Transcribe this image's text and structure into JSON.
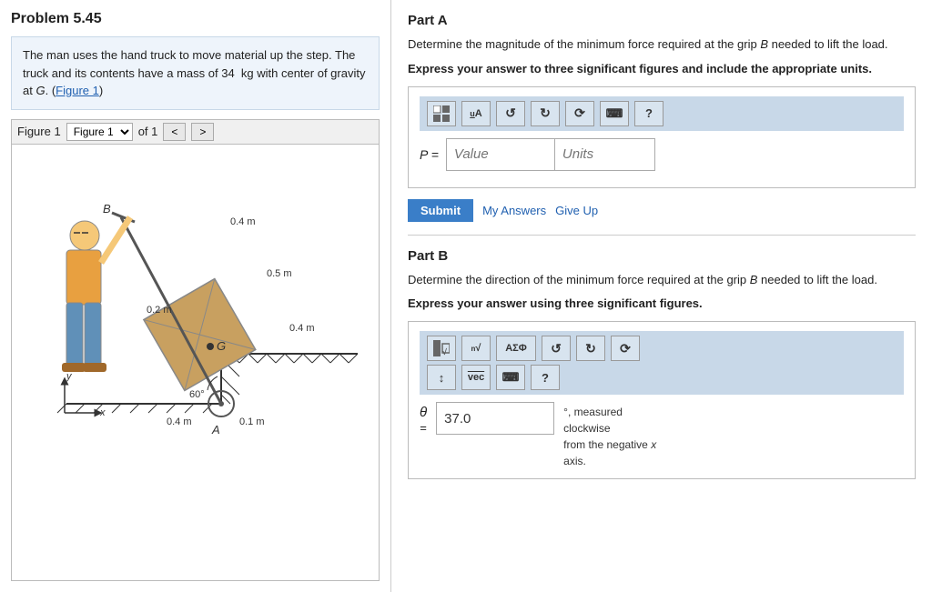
{
  "left": {
    "problem_title": "Problem 5.45",
    "description": "The man uses the hand truck to move material up the step. The truck and its contents have a mass of 34  kg with center of gravity at G. (Figure 1)",
    "description_link": "Figure 1",
    "figure_label": "Figure 1",
    "figure_of": "of 1",
    "nav_prev": "<",
    "nav_next": ">",
    "figure_labels": {
      "B": "B",
      "G": "G",
      "A": "A",
      "x_axis": "x",
      "y_axis": "y",
      "dim_04m_top": "0.4 m",
      "dim_05m": "0.5 m",
      "dim_02m": "0.2 m",
      "dim_04m_right": "0.4 m",
      "dim_04m_bottom": "0.4 m",
      "dim_01m": "0.1 m",
      "angle_60": "60°"
    }
  },
  "right": {
    "part_a": {
      "title": "Part A",
      "description": "Determine the magnitude of the minimum force required at the grip B needed to lift the load.",
      "instruction": "Express your answer to three significant figures and include the appropriate units.",
      "p_label": "P =",
      "value_placeholder": "Value",
      "units_placeholder": "Units",
      "submit_label": "Submit",
      "my_answers_label": "My Answers",
      "give_up_label": "Give Up",
      "toolbar": {
        "grid_icon": "grid",
        "ua_icon": "uA",
        "undo_icon": "undo",
        "redo_icon": "redo",
        "reset_icon": "reset",
        "keyboard_icon": "keyboard",
        "help_icon": "help"
      }
    },
    "part_b": {
      "title": "Part B",
      "description": "Determine the direction of the minimum force required at the grip B needed to lift the load.",
      "instruction": "Express your answer using three significant figures.",
      "theta_label": "θ",
      "equals_label": "=",
      "value": "37.0",
      "note": "°, measured\nclockwise\nfrom the negative x\naxis.",
      "toolbar": {
        "block_icon": "block",
        "sqrt_icon": "√",
        "alpha_sigma_phi": "ΑΣΦ",
        "undo_icon": "undo",
        "redo_icon": "redo",
        "reset_icon": "reset",
        "updown_icon": "↕",
        "vec_icon": "vec",
        "keyboard_icon": "keyboard",
        "help_icon": "help"
      }
    }
  }
}
